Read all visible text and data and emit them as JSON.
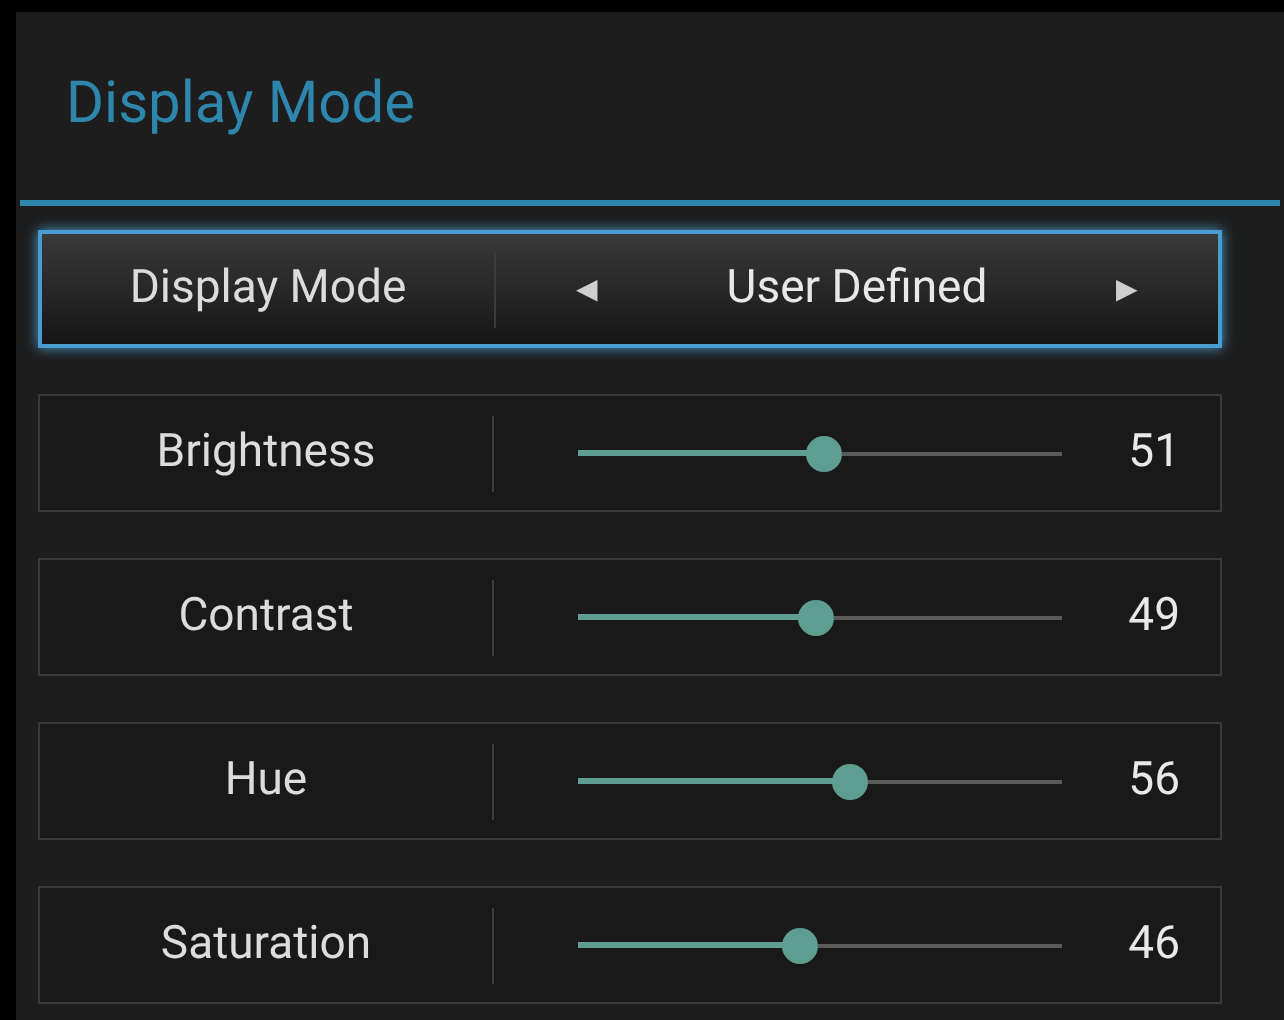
{
  "title": "Display Mode",
  "rows": [
    {
      "kind": "selector",
      "label": "Display Mode",
      "value": "User Defined",
      "selected": true,
      "prev": "◀",
      "next": "▶"
    },
    {
      "kind": "slider",
      "label": "Brightness",
      "level": 0.51,
      "reading": "51",
      "selected": false
    },
    {
      "kind": "slider",
      "label": "Contrast",
      "level": 0.49,
      "reading": "49",
      "selected": false
    },
    {
      "kind": "slider",
      "label": "Hue",
      "level": 0.56,
      "reading": "56",
      "selected": false
    },
    {
      "kind": "slider",
      "label": "Saturation",
      "level": 0.46,
      "reading": "46",
      "selected": false
    }
  ]
}
